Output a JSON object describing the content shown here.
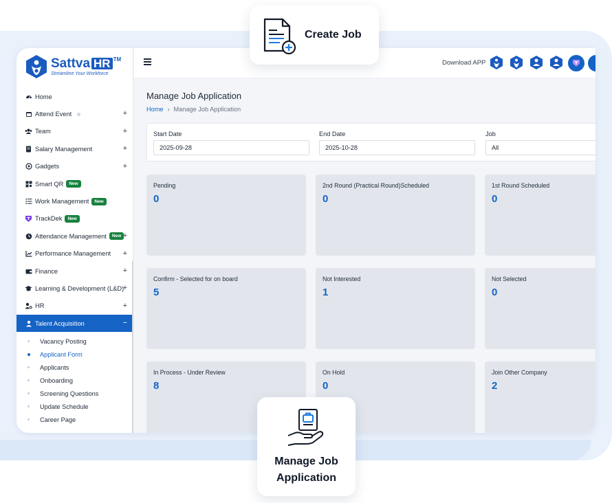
{
  "brand": {
    "name": "Sattva",
    "name_highlight": "HR",
    "trademark": "TM",
    "tagline": "Streamline Your Workforce",
    "color": "#1b5bbf"
  },
  "sidebar": {
    "items": [
      {
        "label": "Home",
        "icon": "dashboard-icon"
      },
      {
        "label": "Attend Event",
        "icon": "calendar-icon",
        "expandable": true
      },
      {
        "label": "Team",
        "icon": "users-icon",
        "expandable": true
      },
      {
        "label": "Salary Management",
        "icon": "document-icon",
        "expandable": true
      },
      {
        "label": "Gadgets",
        "icon": "gadget-icon",
        "expandable": true
      },
      {
        "label": "Smart QR",
        "icon": "qr-icon",
        "badge": "New"
      },
      {
        "label": "Work Management",
        "icon": "list-icon",
        "badge": "New"
      },
      {
        "label": "TrackDek",
        "icon": "trackdek-icon",
        "badge": "New"
      },
      {
        "label": "Attendance Management",
        "icon": "clock-icon",
        "badge": "New",
        "expandable": true
      },
      {
        "label": "Performance Management",
        "icon": "chart-icon",
        "expandable": true
      },
      {
        "label": "Finance",
        "icon": "wallet-icon",
        "expandable": true
      },
      {
        "label": "Learning & Development (L&D)",
        "icon": "graduation-icon",
        "expandable": true
      },
      {
        "label": "HR",
        "icon": "user-cog-icon",
        "expandable": true
      },
      {
        "label": "Talent Acquisition",
        "icon": "user-icon",
        "active": true,
        "expanded_symbol": "−"
      }
    ],
    "plus_symbol": "+",
    "submenu": [
      {
        "label": "Vacancy Posting"
      },
      {
        "label": "Applicant Form",
        "current": true
      },
      {
        "label": "Applicants"
      },
      {
        "label": "Onboarding"
      },
      {
        "label": "Screening Questions"
      },
      {
        "label": "Update Schedule"
      },
      {
        "label": "Career Page"
      }
    ]
  },
  "header": {
    "download_label": "Download APP",
    "icons": [
      "app-icon-1",
      "app-icon-2",
      "app-icon-3",
      "app-icon-4",
      "trackdek-app-icon"
    ]
  },
  "page": {
    "title": "Manage Job Application",
    "breadcrumb": {
      "home": "Home",
      "separator": "›",
      "current": "Manage Job Application"
    }
  },
  "filters": {
    "start_date": {
      "label": "Start Date",
      "value": "2025-09-28"
    },
    "end_date": {
      "label": "End Date",
      "value": "2025-10-28"
    },
    "job": {
      "label": "Job",
      "value": "All"
    }
  },
  "stats": [
    {
      "label": "Pending",
      "value": "0"
    },
    {
      "label": "2nd Round (Practical Round)Scheduled",
      "value": "0"
    },
    {
      "label": "1st Round Scheduled",
      "value": "0"
    },
    {
      "label": "Confirm - Selected for on board",
      "value": "5"
    },
    {
      "label": "Not Interested",
      "value": "1"
    },
    {
      "label": "Not Selected",
      "value": "0"
    },
    {
      "label": "In Process - Under Review",
      "value": "8"
    },
    {
      "label": "On Hold",
      "value": "0"
    },
    {
      "label": "Join Other Company",
      "value": "2"
    }
  ],
  "callouts": {
    "create_job": "Create Job",
    "manage_line1": "Manage Job",
    "manage_line2": "Application"
  },
  "colors": {
    "accent": "#1463c5",
    "badge_green": "#17823f",
    "card_bg": "#e2e6ec"
  }
}
